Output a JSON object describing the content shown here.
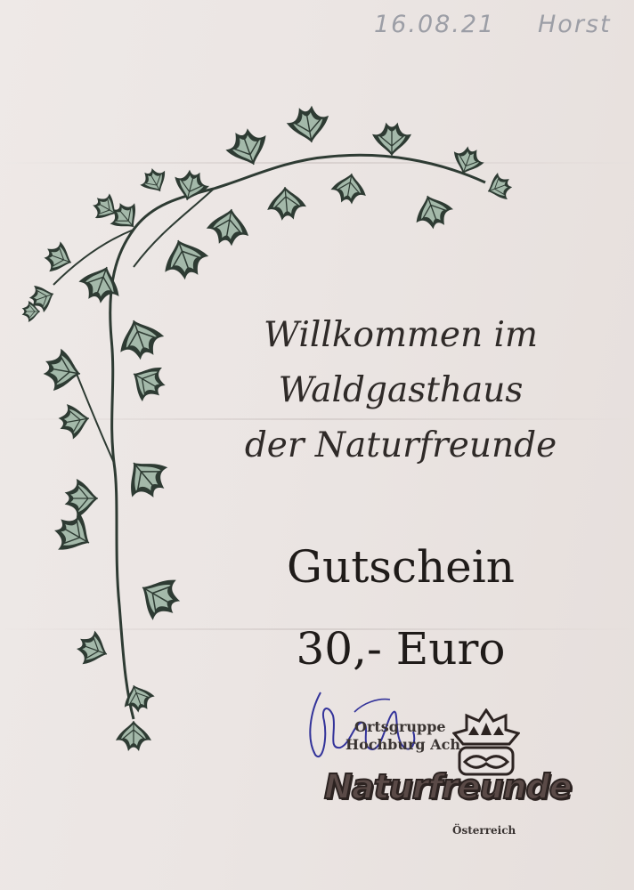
{
  "handwritten": {
    "date": "16.08.21",
    "name": "Horst"
  },
  "welcome": {
    "line1": "Willkommen im",
    "line2": "Waldgasthaus",
    "line3": "der Naturfreunde"
  },
  "voucher": {
    "title": "Gutschein",
    "amount": "30,- Euro"
  },
  "stamp": {
    "line1": "Ortsgruppe",
    "line2": "Hochburg Ach",
    "brand": "Naturfreunde",
    "country": "Österreich"
  },
  "colors": {
    "ivy_dark": "#2e3b33",
    "ivy_light": "#c4d8c9",
    "signature_ink": "#33339a"
  }
}
